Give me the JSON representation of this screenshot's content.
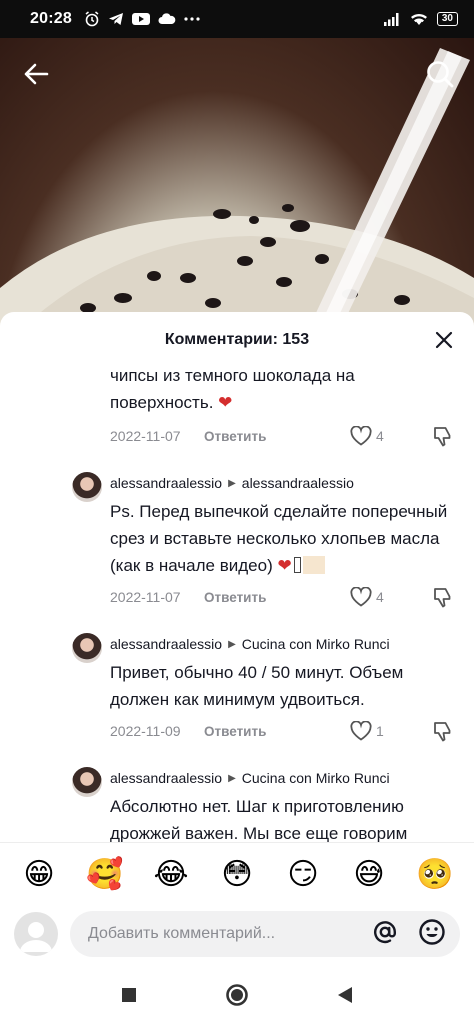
{
  "status_bar": {
    "time": "20:28",
    "battery": "30"
  },
  "sheet": {
    "title": "Комментарии: 153"
  },
  "comments": [
    {
      "text": "чипсы из темного шоколада на поверхность.",
      "emoji": "❤",
      "date": "2022-11-07",
      "reply_label": "Ответить",
      "likes": "4"
    },
    {
      "author": "alessandraalessio",
      "reply_to": "alessandraalessio",
      "text": "Ps. Перед выпечкой сделайте поперечный срез и вставьте несколько хлопьев масла (как в начале видео)",
      "emoji": "❤",
      "date": "2022-11-07",
      "reply_label": "Ответить",
      "likes": "4"
    },
    {
      "author": "alessandraalessio",
      "reply_to": "Cucina con Mirko Runci",
      "text": "Привет, обычно 40 / 50 минут. Объем должен как минимум удвоиться.",
      "date": "2022-11-09",
      "reply_label": "Ответить",
      "likes": "1"
    },
    {
      "author": "alessandraalessio",
      "reply_to": "Cucina con Mirko Runci",
      "text": "Абсолютно нет. Шаг к приготовлению дрожжей важен. Мы все еще говорим"
    }
  ],
  "emoji_bar": [
    "😁",
    "🥰",
    "😂",
    "😳",
    "😏",
    "😅",
    "🥺"
  ],
  "input": {
    "placeholder": "Добавить комментарий..."
  },
  "icons": {
    "back": "arrow-left-icon",
    "search": "search-icon",
    "close": "close-icon",
    "heart": "heart-outline-icon",
    "dislike": "thumbs-down-icon",
    "mention": "at-icon",
    "emoji": "emoji-icon"
  }
}
